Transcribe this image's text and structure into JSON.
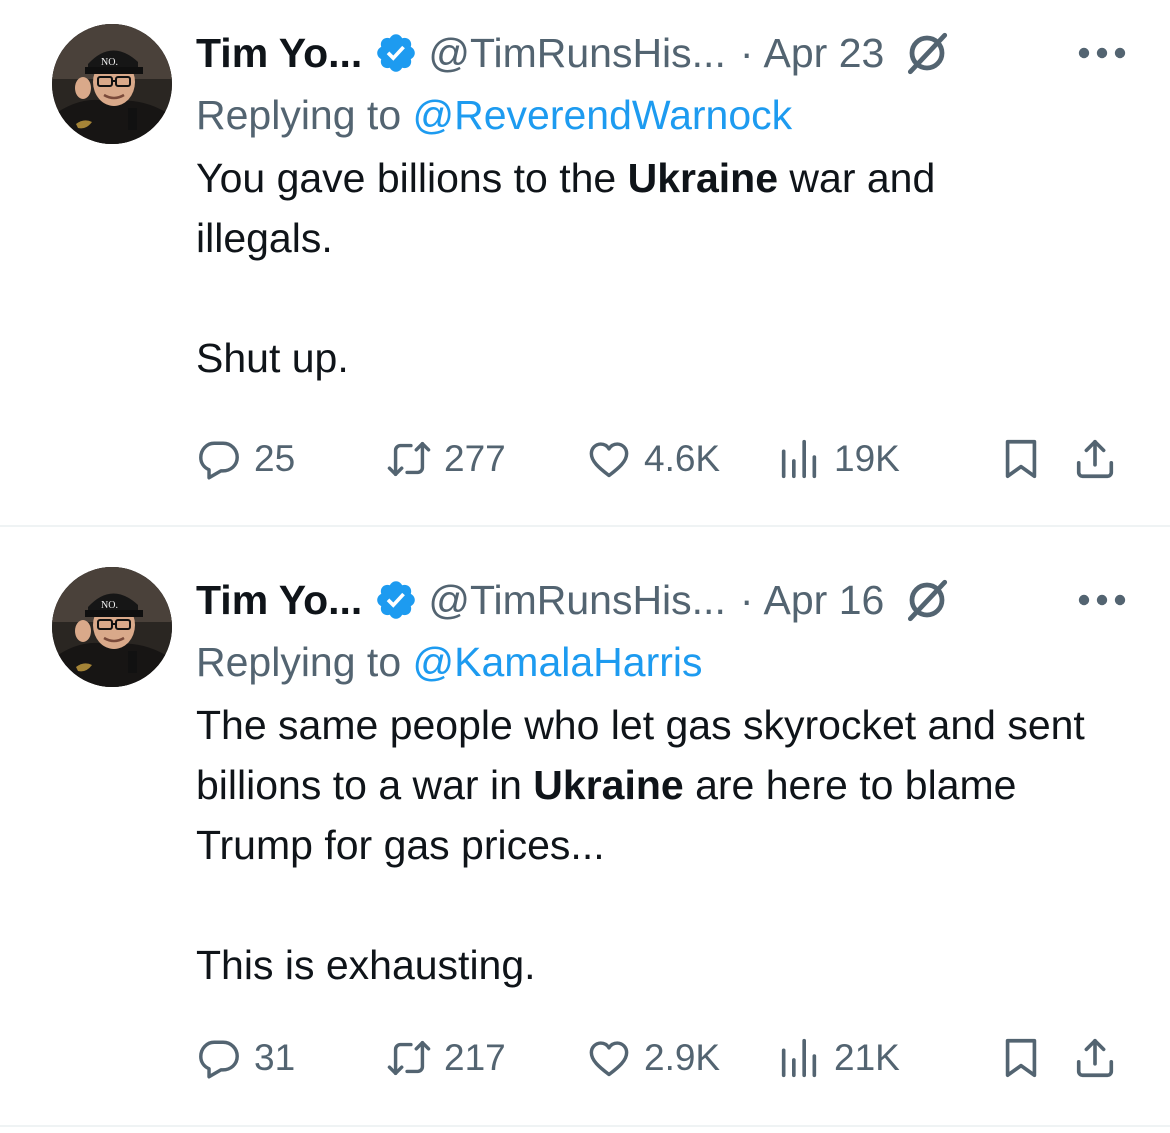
{
  "colors": {
    "text": "#0f1419",
    "secondary": "#536471",
    "link": "#1d9bf0",
    "verified": "#1d9bf0",
    "divider": "#eff3f4"
  },
  "tweets": [
    {
      "name": "Tim Yo...",
      "handle": "@TimRunsHis...",
      "separator": "·",
      "date": "Apr 23",
      "replying_prefix": "Replying to ",
      "replying_to": "@ReverendWarnock",
      "body": {
        "l1_before": "You gave billions to the ",
        "l1_bold": "Ukraine",
        "l1_after": " war and illegals.",
        "p2": "Shut up."
      },
      "stats": {
        "replies": "25",
        "reposts": "277",
        "likes": "4.6K",
        "views": "19K"
      }
    },
    {
      "name": "Tim Yo...",
      "handle": "@TimRunsHis...",
      "separator": "·",
      "date": "Apr 16",
      "replying_prefix": "Replying to ",
      "replying_to": "@KamalaHarris",
      "body": {
        "l1_before": "The same people who let gas skyrocket and sent billions to a war in ",
        "l1_bold": "Ukraine",
        "l1_after": " are here to blame Trump for gas prices...",
        "p2": "This is exhausting."
      },
      "stats": {
        "replies": "31",
        "reposts": "217",
        "likes": "2.9K",
        "views": "21K"
      }
    }
  ],
  "icons": [
    "avatar",
    "verified-badge-icon",
    "grok-icon",
    "more-icon",
    "reply-icon",
    "repost-icon",
    "like-icon",
    "views-icon",
    "bookmark-icon",
    "share-icon"
  ]
}
